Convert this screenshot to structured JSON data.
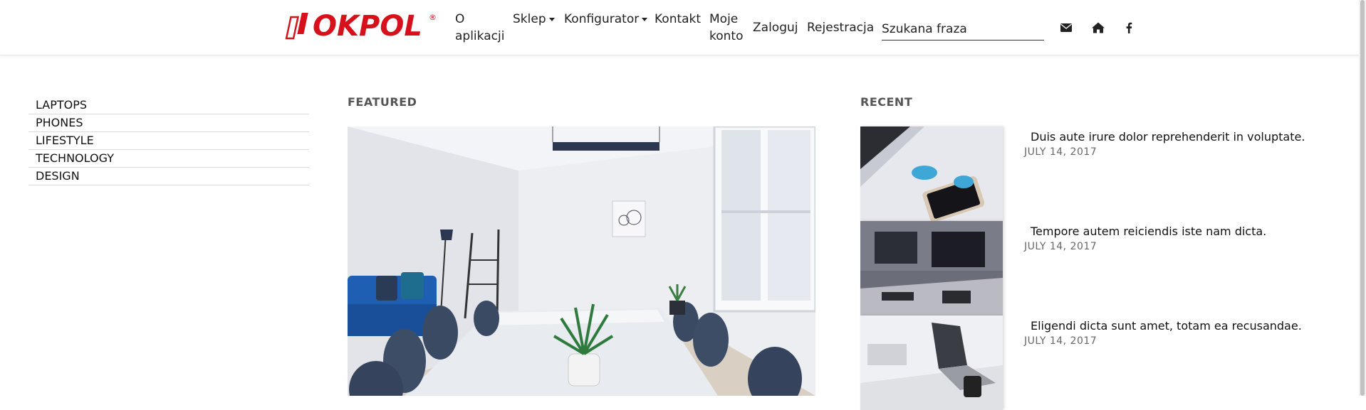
{
  "header": {
    "logo_text": "OKPOL",
    "logo_mark": "®",
    "nav": [
      {
        "label": "O aplikacji",
        "dropdown": false
      },
      {
        "label": "Sklep",
        "dropdown": true
      },
      {
        "label": "Konfigurator",
        "dropdown": true
      },
      {
        "label": "Kontakt",
        "dropdown": false
      },
      {
        "label": "Moje konto",
        "dropdown": false
      },
      {
        "label": "Zaloguj",
        "dropdown": false
      },
      {
        "label": "Rejestracja",
        "dropdown": false
      }
    ],
    "search": {
      "placeholder": "Szukana fraza",
      "value": ""
    },
    "icons": [
      "envelope-icon",
      "home-icon",
      "facebook-icon"
    ]
  },
  "sidebar": {
    "categories": [
      "LAPTOPS",
      "PHONES",
      "LIFESTYLE",
      "TECHNOLOGY",
      "DESIGN"
    ]
  },
  "featured": {
    "heading": "FEATURED",
    "image": "office-meeting-room"
  },
  "recent": {
    "heading": "RECENT",
    "items": [
      {
        "title": "Duis aute irure dolor reprehenderit in voluptate.",
        "date": "JULY 14, 2017",
        "image": "laptop-phone"
      },
      {
        "title": "Tempore autem reiciendis iste nam dicta.",
        "date": "JULY 14, 2017",
        "image": "desk-monitor"
      },
      {
        "title": "Eligendi dicta sunt amet, totam ea recusandae.",
        "date": "JULY 14, 2017",
        "image": "laptop-desk"
      }
    ]
  },
  "colors": {
    "brand_red": "#d6111c",
    "text": "#222222",
    "muted": "#666666",
    "divider": "#dadada"
  }
}
